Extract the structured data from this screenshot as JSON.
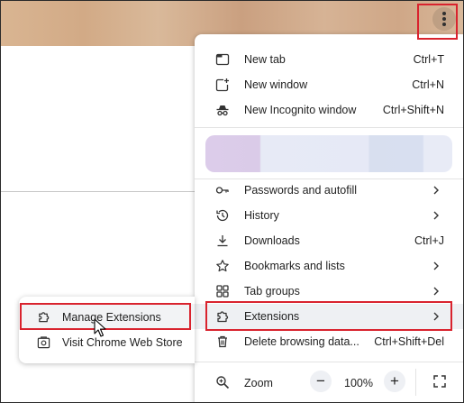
{
  "menu": {
    "items": [
      {
        "label": "New tab",
        "shortcut": "Ctrl+T",
        "icon": "new-tab-icon"
      },
      {
        "label": "New window",
        "shortcut": "Ctrl+N",
        "icon": "new-window-icon"
      },
      {
        "label": "New Incognito window",
        "shortcut": "Ctrl+Shift+N",
        "icon": "incognito-icon"
      },
      {
        "label": "Passwords and autofill",
        "icon": "key-icon"
      },
      {
        "label": "History",
        "icon": "history-icon"
      },
      {
        "label": "Downloads",
        "shortcut": "Ctrl+J",
        "icon": "download-icon"
      },
      {
        "label": "Bookmarks and lists",
        "icon": "star-icon"
      },
      {
        "label": "Tab groups",
        "icon": "tab-groups-icon"
      },
      {
        "label": "Extensions",
        "icon": "puzzle-icon"
      },
      {
        "label": "Delete browsing data...",
        "shortcut": "Ctrl+Shift+Del",
        "icon": "trash-icon"
      }
    ],
    "zoom": {
      "label": "Zoom",
      "value": "100%",
      "minus": "−",
      "plus": "+"
    }
  },
  "submenu": {
    "items": [
      {
        "label": "Manage Extensions",
        "icon": "puzzle-outline-icon"
      },
      {
        "label": "Visit Chrome Web Store",
        "icon": "web-store-icon"
      }
    ]
  },
  "colors": {
    "highlight_border": "#d9232e",
    "menu_bg": "#ffffff",
    "topbar": "#d2aa86"
  }
}
